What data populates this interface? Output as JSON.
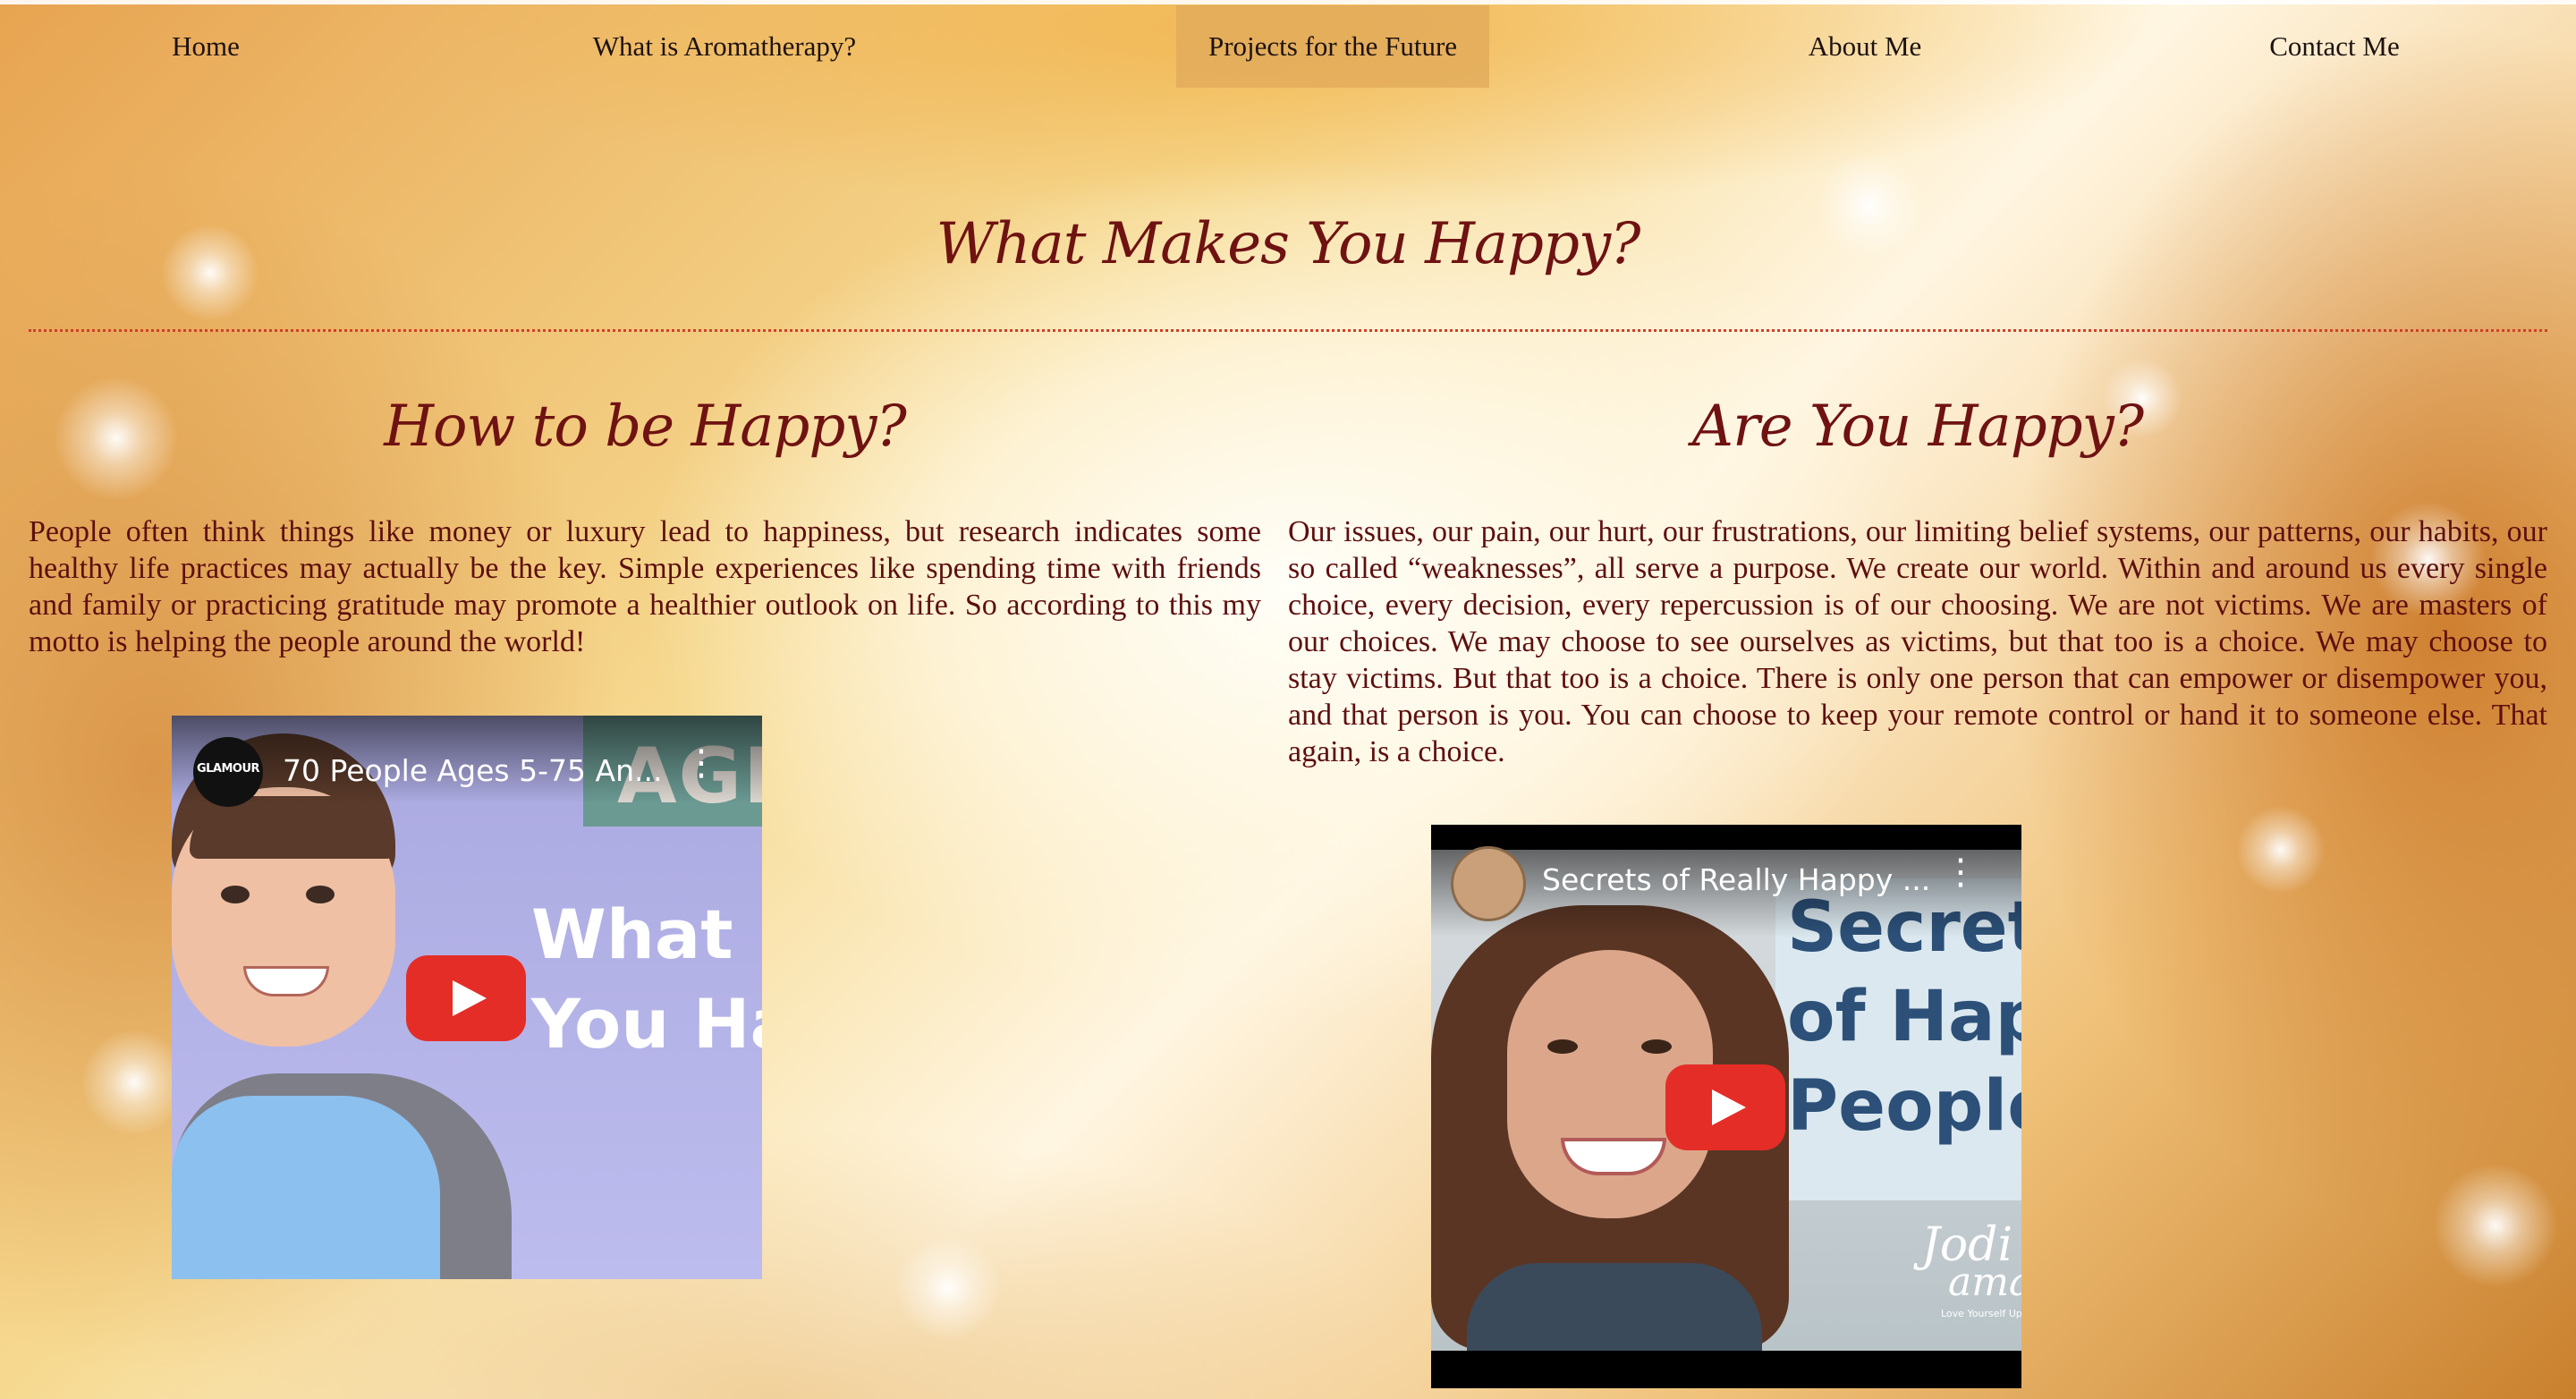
{
  "nav": {
    "items": [
      {
        "label": "Home"
      },
      {
        "label": "What is Aromatherapy?"
      },
      {
        "label": "Projects for the Future"
      },
      {
        "label": "About Me"
      },
      {
        "label": "Contact Me"
      }
    ],
    "active_index": 2
  },
  "page_title": "What Makes You Happy?",
  "left": {
    "heading": "How to be Happy?",
    "body": "People often think things like money or luxury lead to happiness, but research indicates some healthy life practices may actually be the key. Simple experiences like spending time with friends and family or practicing gratitude may promote a healthier outlook on life. So according to this my motto is helping the people around the world!",
    "video": {
      "channel_label": "GLAMOUR",
      "title": "70 People Ages 5-75 An...",
      "thumb_text_top": "What M",
      "thumb_text_bottom": "You Ha",
      "thumb_badge": "AGE"
    }
  },
  "right": {
    "heading": "Are You Happy?",
    "body": "Our issues, our pain, our hurt, our frustrations, our limiting belief systems, our patterns, our habits, our so called “weaknesses”, all serve a purpose. We create our world. Within and around us every single choice, every decision, every repercussion is of our choosing. We are not victims. We are masters of our choices. We may choose to see ourselves as victims, but that too is a choice. We may choose to stay victims. But that too is a choice. There is only one person that can empower or disempower you, and that person is you. You can choose to keep your remote control or hand it to someone else. That again, is a choice.",
    "video": {
      "title": "Secrets of Really Happy ...",
      "thumb_text": [
        "Secrets",
        "of Happ",
        "People"
      ],
      "signature": "Jodi",
      "signature_2": "aman",
      "tagline": "Love Yourself Up"
    }
  },
  "colors": {
    "heading": "#6f1212",
    "body_text": "#5e0f0f",
    "divider": "#d0402a",
    "nav_active_bg": "#e2ac5c",
    "youtube_red": "#e52d27"
  }
}
